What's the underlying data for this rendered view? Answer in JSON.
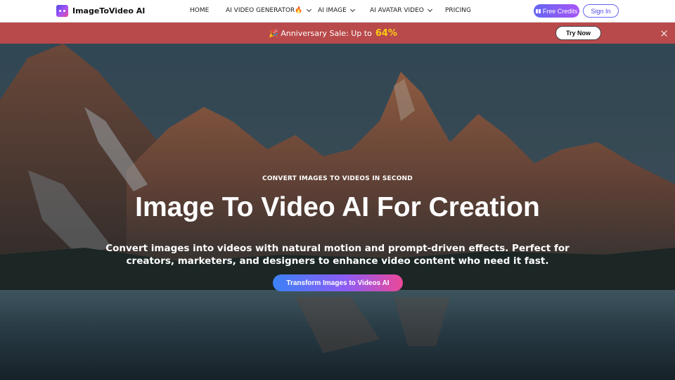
{
  "brand": {
    "name": "ImageToVideo AI"
  },
  "nav": {
    "home": "HOME",
    "video_generator": "AI VIDEO GENERATOR🔥",
    "image": "AI IMAGE",
    "avatar": "AI AVATAR VIDEO",
    "pricing": "PRICING"
  },
  "header": {
    "free_credits": "Free Credits",
    "sign_in": "Sign In"
  },
  "promo": {
    "text": "🎉 Anniversary Sale: Up to",
    "percent": "64%",
    "cta": "Try Now"
  },
  "hero": {
    "eyebrow": "CONVERT IMAGES TO VIDEOS IN SECOND",
    "title": "Image To Video AI For Creation",
    "subtitle": "Convert images into videos with natural motion and prompt-driven effects. Perfect for creators, marketers, and designers to enhance video content who need it fast.",
    "cta": "Transform Images to Videos AI"
  },
  "colors": {
    "accent": "#6366f1",
    "promo_bg": "#b94a4b",
    "promo_highlight": "#facc15"
  }
}
